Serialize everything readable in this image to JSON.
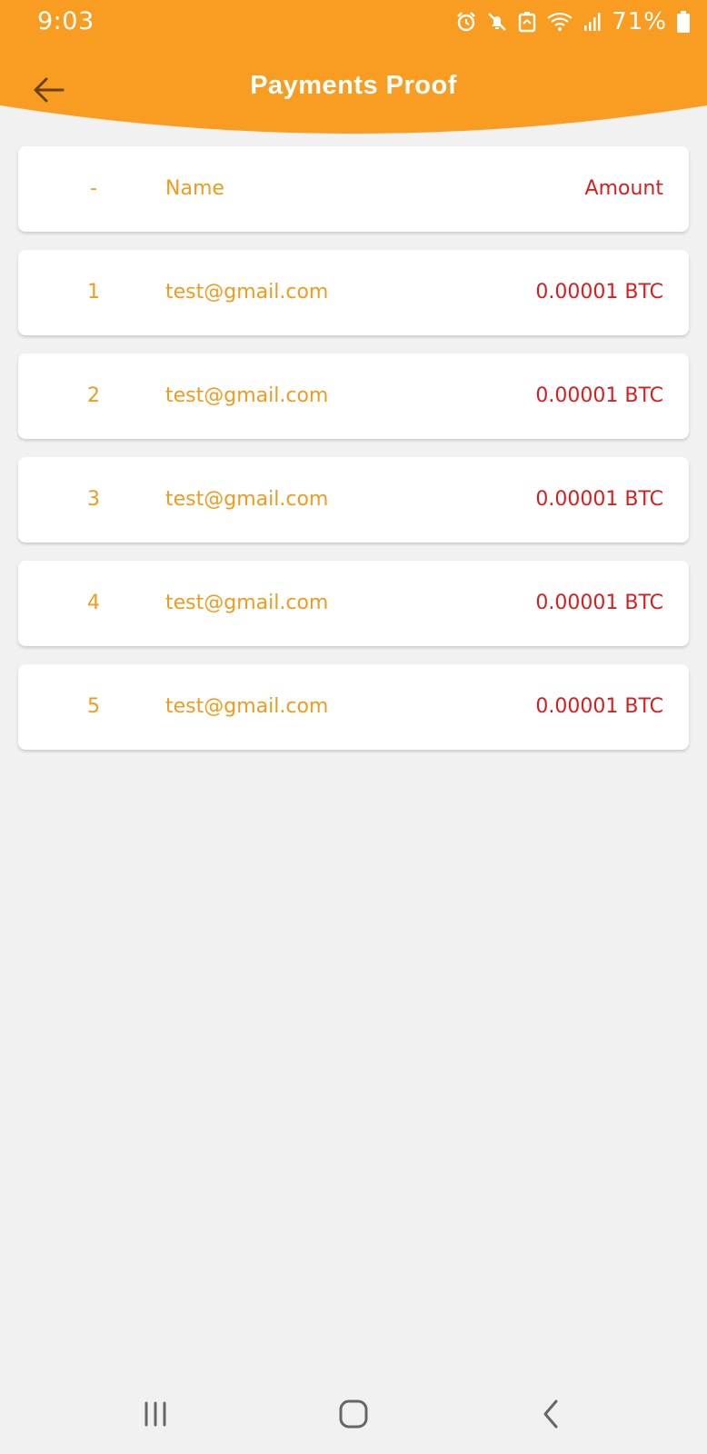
{
  "status_bar": {
    "time": "9:03",
    "battery": "71%",
    "icons": [
      "alarm-icon",
      "mute-icon",
      "data-saver-icon",
      "wifi-icon",
      "signal-icon",
      "battery-icon"
    ]
  },
  "header": {
    "title": "Payments Proof",
    "back_icon": "arrow-left-icon",
    "background_color": "#f99d22"
  },
  "table": {
    "columns": {
      "index": "-",
      "name": "Name",
      "amount": "Amount"
    },
    "rows": [
      {
        "index": "1",
        "name": "test@gmail.com",
        "amount": "0.00001 BTC"
      },
      {
        "index": "2",
        "name": "test@gmail.com",
        "amount": "0.00001 BTC"
      },
      {
        "index": "3",
        "name": "test@gmail.com",
        "amount": "0.00001 BTC"
      },
      {
        "index": "4",
        "name": "test@gmail.com",
        "amount": "0.00001 BTC"
      },
      {
        "index": "5",
        "name": "test@gmail.com",
        "amount": "0.00001 BTC"
      }
    ]
  },
  "colors": {
    "accent": "#f29a1d",
    "amount": "#d81e1e",
    "background": "#f1f1f1"
  },
  "nav_bar": {
    "icons": [
      "recent-apps-icon",
      "home-icon",
      "back-icon"
    ]
  }
}
